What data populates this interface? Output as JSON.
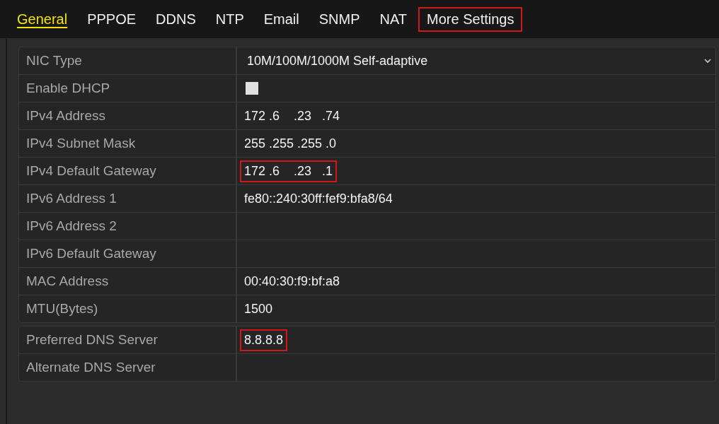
{
  "tabs": [
    {
      "label": "General",
      "selected": true,
      "highlighted": false
    },
    {
      "label": "PPPOE",
      "selected": false,
      "highlighted": false
    },
    {
      "label": "DDNS",
      "selected": false,
      "highlighted": false
    },
    {
      "label": "NTP",
      "selected": false,
      "highlighted": false
    },
    {
      "label": "Email",
      "selected": false,
      "highlighted": false
    },
    {
      "label": "SNMP",
      "selected": false,
      "highlighted": false
    },
    {
      "label": "NAT",
      "selected": false,
      "highlighted": false
    },
    {
      "label": "More Settings",
      "selected": false,
      "highlighted": true
    }
  ],
  "groups": [
    {
      "rows": [
        {
          "label": "NIC Type",
          "kind": "select",
          "value": "10M/100M/1000M Self-adaptive"
        },
        {
          "label": "Enable DHCP",
          "kind": "checkbox",
          "checked": false
        },
        {
          "label": "IPv4 Address",
          "kind": "text",
          "value": "172 .6    .23   .74",
          "highlighted": false
        },
        {
          "label": "IPv4 Subnet Mask",
          "kind": "text",
          "value": "255 .255 .255 .0",
          "highlighted": false
        },
        {
          "label": "IPv4 Default Gateway",
          "kind": "text",
          "value": "172 .6    .23   .1",
          "highlighted": true
        },
        {
          "label": "IPv6 Address 1",
          "kind": "text",
          "value": "fe80::240:30ff:fef9:bfa8/64",
          "highlighted": false
        },
        {
          "label": "IPv6 Address 2",
          "kind": "text"
        },
        {
          "label": "IPv6 Default Gateway",
          "kind": "text"
        },
        {
          "label": "MAC Address",
          "kind": "text",
          "value": "00:40:30:f9:bf:a8",
          "highlighted": false
        },
        {
          "label": "MTU(Bytes)",
          "kind": "text",
          "value": "1500",
          "highlighted": false
        }
      ]
    },
    {
      "rows": [
        {
          "label": "Preferred DNS Server",
          "kind": "text",
          "value": "8.8.8.8",
          "highlighted": true
        },
        {
          "label": "Alternate DNS Server",
          "kind": "text"
        }
      ]
    }
  ]
}
